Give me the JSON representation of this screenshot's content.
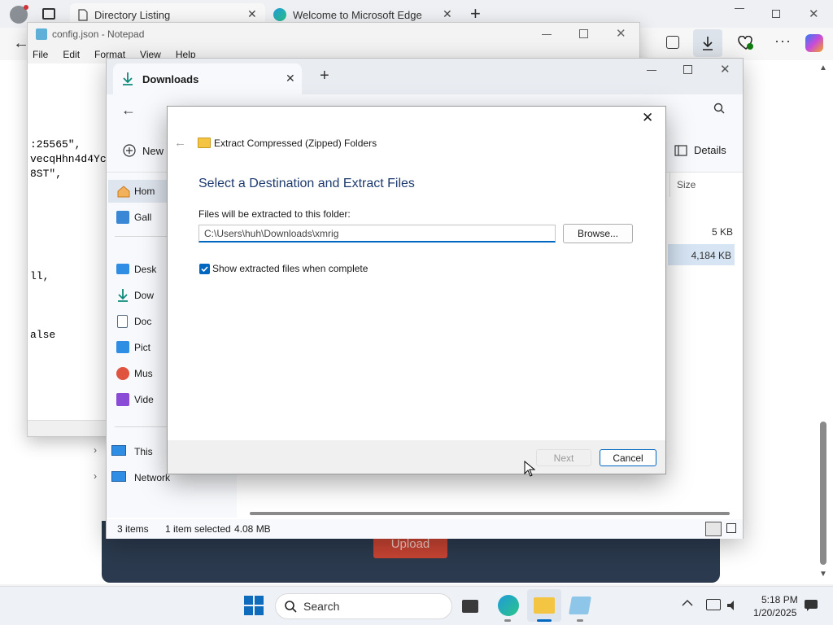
{
  "browser": {
    "tabs": [
      {
        "label": "Directory Listing"
      },
      {
        "label": "Welcome to Microsoft Edge"
      }
    ],
    "page_button": "Upload"
  },
  "notepad": {
    "title": "config.json - Notepad",
    "menu": [
      "File",
      "Edit",
      "Format",
      "View",
      "Help"
    ],
    "lines": [
      ":25565\",",
      "vecqHhn4d4Yc",
      "8ST\",",
      "ll,",
      "alse"
    ]
  },
  "explorer": {
    "tab_title": "Downloads",
    "new_label": "New",
    "details_label": "Details",
    "column_size": "Size",
    "sizes": [
      "5 KB",
      "4,184 KB"
    ],
    "nav": [
      "Hom",
      "Gall",
      "Desk",
      "Dow",
      "Doc",
      "Pict",
      "Mus",
      "Vide",
      "This",
      "Network"
    ],
    "status": {
      "items": "3 items",
      "selected": "1 item selected",
      "size": "4.08 MB"
    }
  },
  "dialog": {
    "window_title": "Extract Compressed (Zipped) Folders",
    "heading": "Select a Destination and Extract Files",
    "folder_label": "Files will be extracted to this folder:",
    "path_value": "C:\\Users\\huh\\Downloads\\xmrig",
    "browse_label": "Browse...",
    "checkbox_label": "Show extracted files when complete",
    "checkbox_checked": true,
    "next_label": "Next",
    "cancel_label": "Cancel"
  },
  "taskbar": {
    "search_placeholder": "Search",
    "time": "5:18 PM",
    "date": "1/20/2025"
  },
  "colors": {
    "accent": "#0067c0",
    "heading": "#1e3a6e",
    "folder": "#f4c542"
  }
}
